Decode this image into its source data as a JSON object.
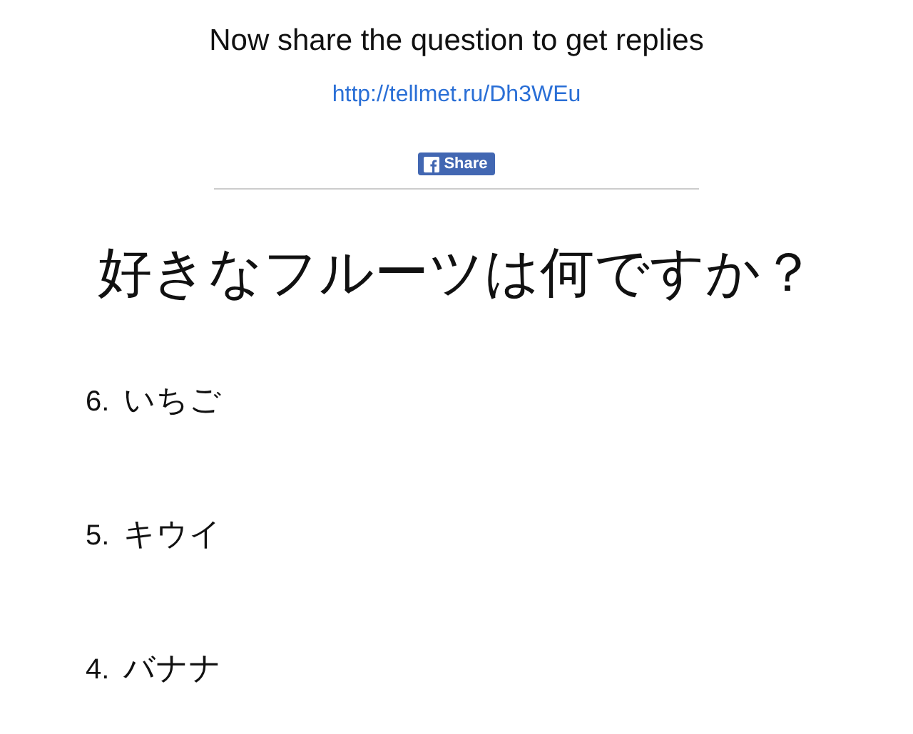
{
  "heading": "Now share the question to get replies",
  "link": "http://tellmet.ru/Dh3WEu",
  "share_button": "Share",
  "question": "好きなフルーツは何ですか？",
  "answers": [
    {
      "number": "6.",
      "text": "いちご"
    },
    {
      "number": "5.",
      "text": "キウイ"
    },
    {
      "number": "4.",
      "text": "バナナ"
    }
  ]
}
